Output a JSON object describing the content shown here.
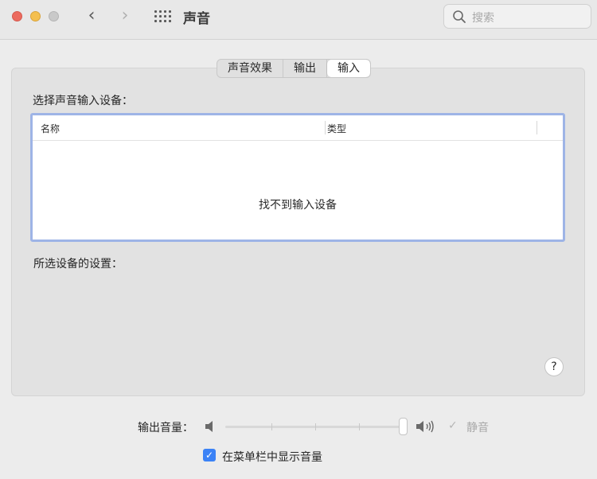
{
  "window": {
    "title": "声音",
    "search_placeholder": "搜索"
  },
  "tabs": [
    {
      "label": "声音效果",
      "active": false
    },
    {
      "label": "输出",
      "active": false
    },
    {
      "label": "输入",
      "active": true
    }
  ],
  "input": {
    "section_label": "选择声音输入设备：",
    "columns": [
      "名称",
      "类型"
    ],
    "empty_message": "找不到输入设备",
    "settings_label": "所选设备的设置："
  },
  "help_label": "?",
  "volume": {
    "label": "输出音量：",
    "level_fraction": 1.0,
    "mute_label": "静音",
    "mute_checked": true,
    "mute_enabled": false
  },
  "menubar_option": {
    "label": "在菜单栏中显示音量",
    "checked": true
  },
  "colors": {
    "accent": "#3b82f6",
    "table_focus_border": "#9eb4e6",
    "close": "#ec6a5e",
    "minimize": "#f4bf4f"
  }
}
